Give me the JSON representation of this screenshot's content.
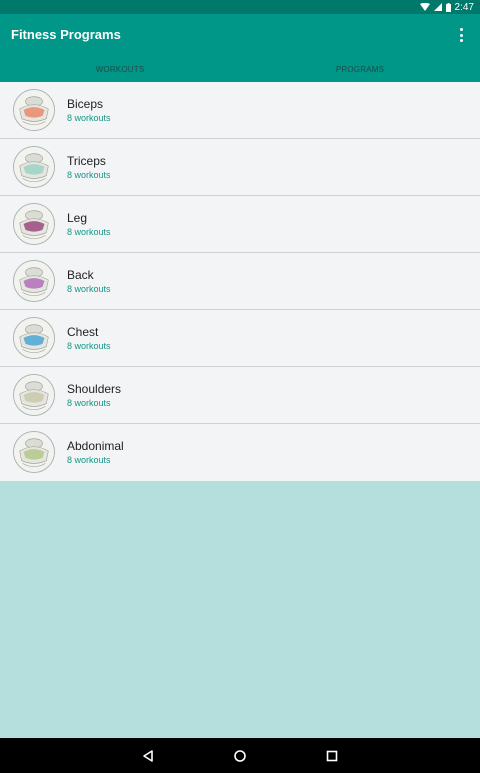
{
  "status_bar": {
    "time": "2:47"
  },
  "app_bar": {
    "title": "Fitness Programs"
  },
  "tabs": [
    {
      "label": "WORKOUTS"
    },
    {
      "label": "PROGRAMS"
    }
  ],
  "programs": [
    {
      "name": "Biceps",
      "count": "8 workouts",
      "accent": "#e9896d"
    },
    {
      "name": "Triceps",
      "count": "8 workouts",
      "accent": "#9bd1c3"
    },
    {
      "name": "Leg",
      "count": "8 workouts",
      "accent": "#9a4a7c"
    },
    {
      "name": "Back",
      "count": "8 workouts",
      "accent": "#b070b8"
    },
    {
      "name": "Chest",
      "count": "8 workouts",
      "accent": "#4aa6d4"
    },
    {
      "name": "Shoulders",
      "count": "8 workouts",
      "accent": "#c8c9a8"
    },
    {
      "name": "Abdonimal",
      "count": "8 workouts",
      "accent": "#b3c88a"
    }
  ],
  "colors": {
    "primary": "#009688",
    "primary_dark": "#00796b",
    "accent_text": "#159687",
    "background": "#b4dfdc"
  },
  "icons": {
    "status": [
      "wifi-icon",
      "signal-icon",
      "battery-icon"
    ],
    "nav": [
      "back-icon",
      "home-icon",
      "recents-icon"
    ]
  }
}
